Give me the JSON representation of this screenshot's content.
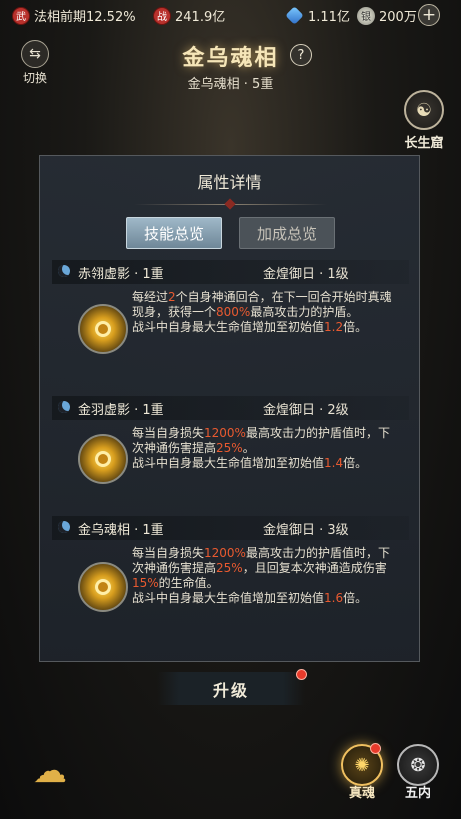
{
  "topbar": {
    "realm": {
      "icon": "realm-icon",
      "icon_text": "武",
      "label": "法相前期12.52%"
    },
    "power": {
      "icon": "battle-power-icon",
      "icon_text": "战",
      "value": "241.9亿"
    },
    "crystal": {
      "icon": "crystal-icon",
      "value": "1.11亿"
    },
    "silver": {
      "icon": "silver-coin-icon",
      "icon_text": "银",
      "value": "200万"
    },
    "add_icon": "plus-icon"
  },
  "header": {
    "switch_label": "切换",
    "title": "金乌魂相",
    "help": "?",
    "subtitle": "金乌魂相 · 5重",
    "longlife_label": "长生窟"
  },
  "panel": {
    "title": "属性详情",
    "tabs": [
      {
        "label": "技能总览",
        "active": true
      },
      {
        "label": "加成总览",
        "active": false
      }
    ],
    "skills": [
      {
        "name": "赤翎虚影 · 1重",
        "level": "金煌御日 · 1级",
        "desc": [
          {
            "t": "每经过"
          },
          {
            "t": "2",
            "hl": true
          },
          {
            "t": "个自身神通回合，在下一回合开始时真魂现身，获得一个"
          },
          {
            "t": "800%",
            "hl": true
          },
          {
            "t": "最高攻击力的护盾。"
          },
          {
            "t": "\n战斗中自身最大生命值增加至初始值"
          },
          {
            "t": "1.2",
            "hl": true
          },
          {
            "t": "倍。"
          }
        ]
      },
      {
        "name": "金羽虚影 · 1重",
        "level": "金煌御日 · 2级",
        "desc": [
          {
            "t": "每当自身损失"
          },
          {
            "t": "1200%",
            "hl": true
          },
          {
            "t": "最高攻击力的护盾值时，下次神通伤害提高"
          },
          {
            "t": "25%",
            "hl": true
          },
          {
            "t": "。"
          },
          {
            "t": "\n战斗中自身最大生命值增加至初始值"
          },
          {
            "t": "1.4",
            "hl": true
          },
          {
            "t": "倍。"
          }
        ]
      },
      {
        "name": "金乌魂相 · 1重",
        "level": "金煌御日 · 3级",
        "desc": [
          {
            "t": "每当自身损失"
          },
          {
            "t": "1200%",
            "hl": true
          },
          {
            "t": "最高攻击力的护盾值时，下次神通伤害提高"
          },
          {
            "t": "25%",
            "hl": true
          },
          {
            "t": "，且回复本次神通造成伤害"
          },
          {
            "t": "15%",
            "hl": true
          },
          {
            "t": "的生命值。"
          },
          {
            "t": "\n战斗中自身最大生命值增加至初始值"
          },
          {
            "t": "1.6",
            "hl": true
          },
          {
            "t": "倍。"
          }
        ]
      }
    ]
  },
  "upgrade_label": "升级",
  "bottom_nav": [
    {
      "label": "真魂",
      "icon": "true-soul-icon",
      "glyph": "✺",
      "active": true,
      "badge": true
    },
    {
      "label": "五内",
      "icon": "five-organs-icon",
      "glyph": "❂",
      "active": false,
      "badge": false
    }
  ],
  "cloud_icon": "auspicious-cloud-icon",
  "colors": {
    "highlight": "#e85a30",
    "gold": "#f6e6b8",
    "badge": "#e83b2b"
  }
}
